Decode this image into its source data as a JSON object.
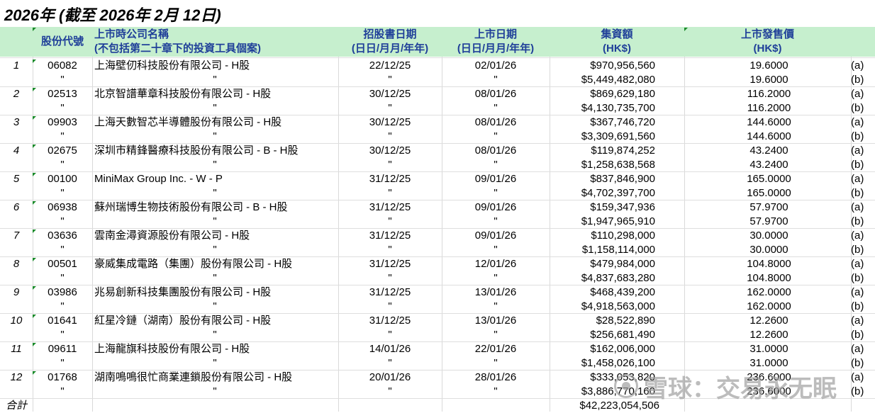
{
  "title": "2026年 (截至 2026年 2月 12日)",
  "headers": {
    "code": "股份代號",
    "name_line1": "上市時公司名稱",
    "name_line2": "(不包括第二十章下的投資工具個案)",
    "prospectus_line1": "招股書日期",
    "prospectus_line2": "(日日/月月/年年)",
    "listing_line1": "上市日期",
    "listing_line2": "(日日/月月/年年)",
    "funds_line1": "集資額",
    "funds_line2": "(HK$)",
    "price_line1": "上市發售價",
    "price_line2": "(HK$)"
  },
  "ditto": "\"",
  "rows": [
    {
      "no": "1",
      "code": "06082",
      "name": "上海壁仞科技股份有限公司 - H股",
      "prospectus": "22/12/25",
      "listing": "02/01/26",
      "funds_a": "$970,956,560",
      "funds_b": "$5,449,482,080",
      "price_a": "19.6000",
      "price_b": "19.6000"
    },
    {
      "no": "2",
      "code": "02513",
      "name": "北京智譜華章科技股份有限公司 - H股",
      "prospectus": "30/12/25",
      "listing": "08/01/26",
      "funds_a": "$869,629,180",
      "funds_b": "$4,130,735,700",
      "price_a": "116.2000",
      "price_b": "116.2000"
    },
    {
      "no": "3",
      "code": "09903",
      "name": "上海天數智芯半導體股份有限公司 - H股",
      "prospectus": "30/12/25",
      "listing": "08/01/26",
      "funds_a": "$367,746,720",
      "funds_b": "$3,309,691,560",
      "price_a": "144.6000",
      "price_b": "144.6000"
    },
    {
      "no": "4",
      "code": "02675",
      "name": "深圳市精鋒醫療科技股份有限公司  - B - H股",
      "prospectus": "30/12/25",
      "listing": "08/01/26",
      "funds_a": "$119,874,252",
      "funds_b": "$1,258,638,568",
      "price_a": "43.2400",
      "price_b": "43.2400"
    },
    {
      "no": "5",
      "code": "00100",
      "name": "MiniMax Group Inc. - W - P",
      "prospectus": "31/12/25",
      "listing": "09/01/26",
      "funds_a": "$837,846,900",
      "funds_b": "$4,702,397,700",
      "price_a": "165.0000",
      "price_b": "165.0000"
    },
    {
      "no": "6",
      "code": "06938",
      "name": "蘇州瑞博生物技術股份有限公司 - B - H股",
      "prospectus": "31/12/25",
      "listing": "09/01/26",
      "funds_a": "$159,347,936",
      "funds_b": "$1,947,965,910",
      "price_a": "57.9700",
      "price_b": "57.9700"
    },
    {
      "no": "7",
      "code": "03636",
      "name": "雲南金潯資源股份有限公司 - H股",
      "prospectus": "31/12/25",
      "listing": "09/01/26",
      "funds_a": "$110,298,000",
      "funds_b": "$1,158,114,000",
      "price_a": "30.0000",
      "price_b": "30.0000"
    },
    {
      "no": "8",
      "code": "00501",
      "name": "豪威集成電路（集團）股份有限公司 - H股",
      "prospectus": "31/12/25",
      "listing": "12/01/26",
      "funds_a": "$479,984,000",
      "funds_b": "$4,837,683,280",
      "price_a": "104.8000",
      "price_b": "104.8000"
    },
    {
      "no": "9",
      "code": "03986",
      "name": "兆易創新科技集團股份有限公司 - H股",
      "prospectus": "31/12/25",
      "listing": "13/01/26",
      "funds_a": "$468,439,200",
      "funds_b": "$4,918,563,000",
      "price_a": "162.0000",
      "price_b": "162.0000"
    },
    {
      "no": "10",
      "code": "01641",
      "name": "紅星冷鏈（湖南）股份有限公司 - H股",
      "prospectus": "31/12/25",
      "listing": "13/01/26",
      "funds_a": "$28,522,890",
      "funds_b": "$256,681,490",
      "price_a": "12.2600",
      "price_b": "12.2600"
    },
    {
      "no": "11",
      "code": "09611",
      "name": "上海龍旗科技股份有限公司 - H股",
      "prospectus": "14/01/26",
      "listing": "22/01/26",
      "funds_a": "$162,006,000",
      "funds_b": "$1,458,026,100",
      "price_a": "31.0000",
      "price_b": "31.0000"
    },
    {
      "no": "12",
      "code": "01768",
      "name": "湖南鳴鳴很忙商業連鎖股份有限公司 - H股",
      "prospectus": "20/01/26",
      "listing": "28/01/26",
      "funds_a": "$333,053,820",
      "funds_b": "$3,886,770,160",
      "price_a": "236.6000",
      "price_b": "236.6000"
    }
  ],
  "tag_a": "(a)",
  "tag_b": "(b)",
  "total_label": "合計",
  "total_funds": "$42,223,054,506",
  "watermark": "雪球：交易永无眠"
}
